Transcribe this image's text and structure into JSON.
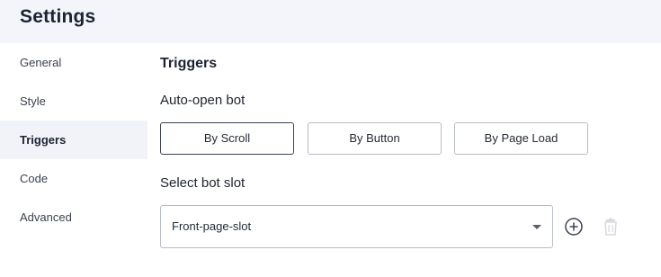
{
  "header": {
    "title": "Settings"
  },
  "sidebar": {
    "items": [
      {
        "label": "General"
      },
      {
        "label": "Style"
      },
      {
        "label": "Triggers"
      },
      {
        "label": "Code"
      },
      {
        "label": "Advanced"
      }
    ],
    "active_index": 2
  },
  "main": {
    "section_title": "Triggers",
    "auto_open_label": "Auto-open bot",
    "trigger_options": [
      {
        "label": "By Scroll"
      },
      {
        "label": "By Button"
      },
      {
        "label": "By Page Load"
      }
    ],
    "selected_trigger_index": 0,
    "bot_slot_label": "Select bot slot",
    "bot_slot_select": {
      "value": "Front-page-slot"
    },
    "icons": {
      "add": "plus-circle-icon",
      "delete": "trash-icon"
    }
  },
  "colors": {
    "header_bg": "#f3f5fa",
    "active_sidebar_bg": "#f1f3f8",
    "border": "#b8bcc6",
    "selected_border": "#3d4254",
    "trash_disabled": "#d5d8de"
  }
}
